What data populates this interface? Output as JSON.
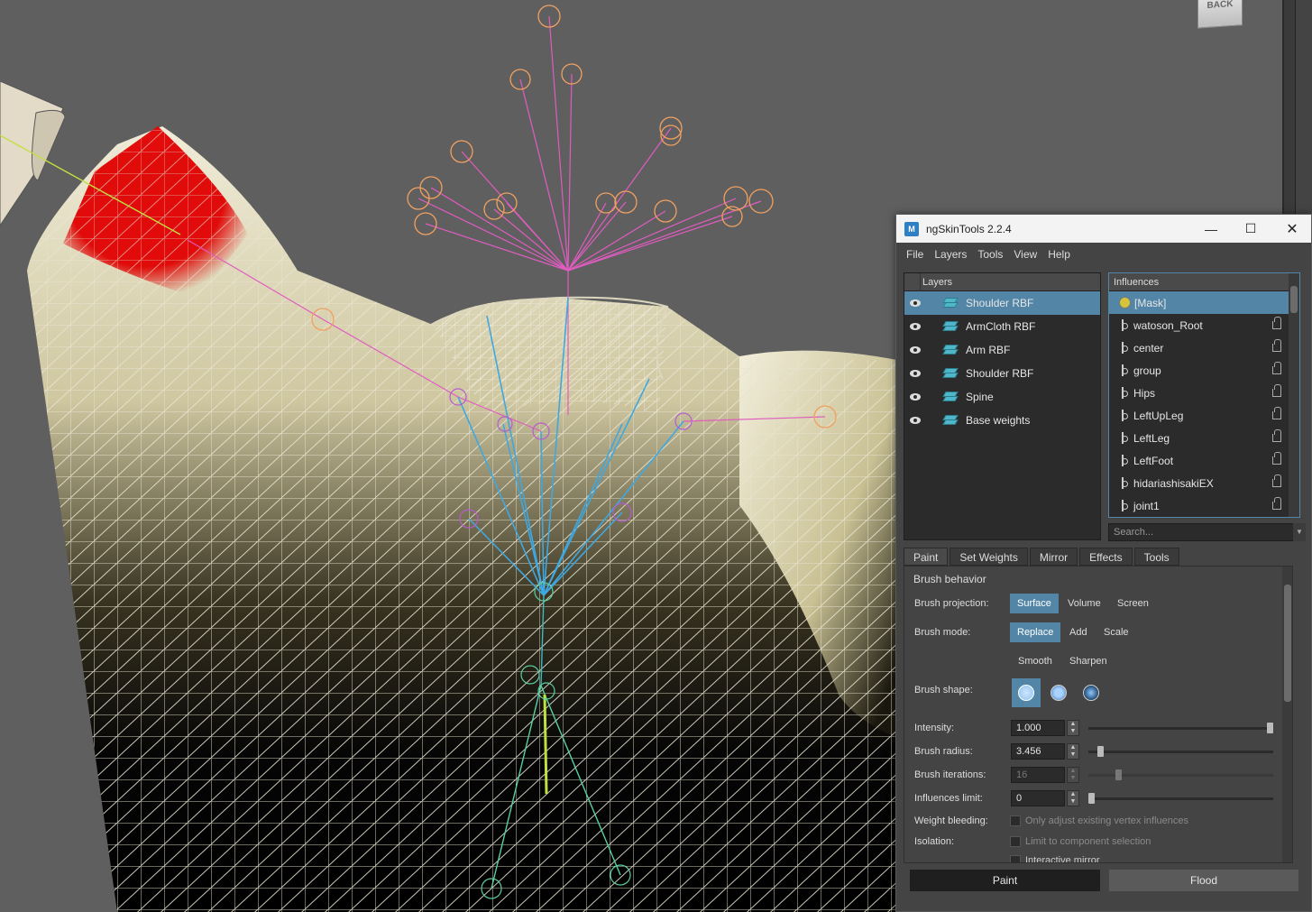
{
  "viewport": {
    "back_label": "BACK"
  },
  "window": {
    "title": "ngSkinTools 2.2.4",
    "icon_label": "M"
  },
  "menu": [
    "File",
    "Layers",
    "Tools",
    "View",
    "Help"
  ],
  "layers": {
    "header": "Layers",
    "items": [
      {
        "name": "Shoulder RBF",
        "selected": true
      },
      {
        "name": "ArmCloth RBF",
        "selected": false
      },
      {
        "name": "Arm RBF",
        "selected": false
      },
      {
        "name": "Shoulder RBF",
        "selected": false
      },
      {
        "name": "Spine",
        "selected": false
      },
      {
        "name": "Base weights",
        "selected": false
      }
    ]
  },
  "influences": {
    "header": "Influences",
    "items": [
      {
        "name": "[Mask]",
        "selected": true
      },
      {
        "name": "watoson_Root"
      },
      {
        "name": "center"
      },
      {
        "name": "group"
      },
      {
        "name": "Hips"
      },
      {
        "name": "LeftUpLeg"
      },
      {
        "name": "LeftLeg"
      },
      {
        "name": "LeftFoot"
      },
      {
        "name": "hidariashisakiEX"
      },
      {
        "name": "joint1"
      }
    ],
    "search_placeholder": "Search..."
  },
  "tabs": [
    "Paint",
    "Set Weights",
    "Mirror",
    "Effects",
    "Tools"
  ],
  "brush": {
    "section_title": "Brush behavior",
    "projection_label": "Brush projection:",
    "projection_options": [
      "Surface",
      "Volume",
      "Screen"
    ],
    "projection_selected": "Surface",
    "mode_label": "Brush mode:",
    "mode_options": [
      "Replace",
      "Add",
      "Scale",
      "Smooth",
      "Sharpen"
    ],
    "mode_selected": "Replace",
    "shape_label": "Brush shape:",
    "intensity_label": "Intensity:",
    "intensity_value": "1.000",
    "intensity_fraction": 1.0,
    "radius_label": "Brush radius:",
    "radius_value": "3.456",
    "radius_fraction": 0.05,
    "iterations_label": "Brush iterations:",
    "iterations_value": "16",
    "iterations_fraction": 0.15,
    "limit_label": "Influences limit:",
    "limit_value": "0",
    "limit_fraction": 0.0,
    "bleeding_label": "Weight bleeding:",
    "bleeding_option": "Only adjust existing vertex influences",
    "isolation_label": "Isolation:",
    "isolation_option": "Limit to component selection",
    "interactive_mirror": "Interactive mirror"
  },
  "actions": {
    "paint": "Paint",
    "flood": "Flood"
  },
  "colors": {
    "accent": "#5285a6",
    "layer_icon": "#4fb7c9",
    "joint_pink": "#e05cc0",
    "joint_orange": "#f0a060",
    "joint_blue": "#3fa8e0",
    "weight_red": "#e00000"
  }
}
